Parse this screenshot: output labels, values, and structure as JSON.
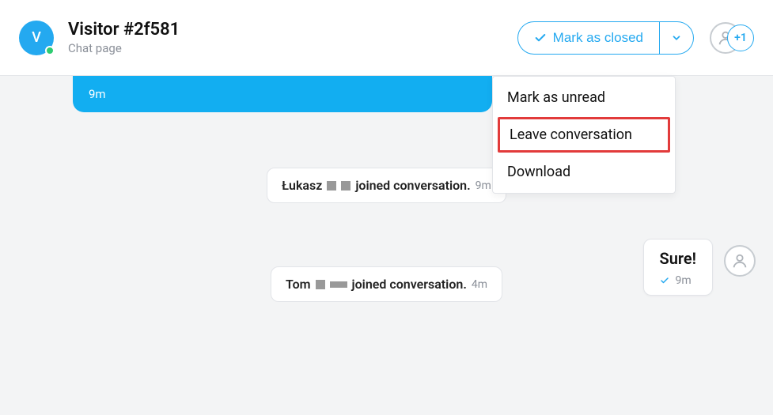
{
  "header": {
    "avatar_initial": "V",
    "title": "Visitor #2f581",
    "subtitle": "Chat page",
    "mark_closed_label": "Mark as closed",
    "plus_label": "+1"
  },
  "dropdown": {
    "items": [
      {
        "label": "Mark as unread",
        "highlight": false
      },
      {
        "label": "Leave conversation",
        "highlight": true
      },
      {
        "label": "Download",
        "highlight": false
      }
    ]
  },
  "blue_message": {
    "time": "9m"
  },
  "system_events": [
    {
      "name": "Łukasz",
      "action": "joined conversation.",
      "time": "9m"
    },
    {
      "name": "Tom",
      "action": "joined conversation.",
      "time": "4m"
    }
  ],
  "reply": {
    "text": "Sure!",
    "time": "9m"
  }
}
